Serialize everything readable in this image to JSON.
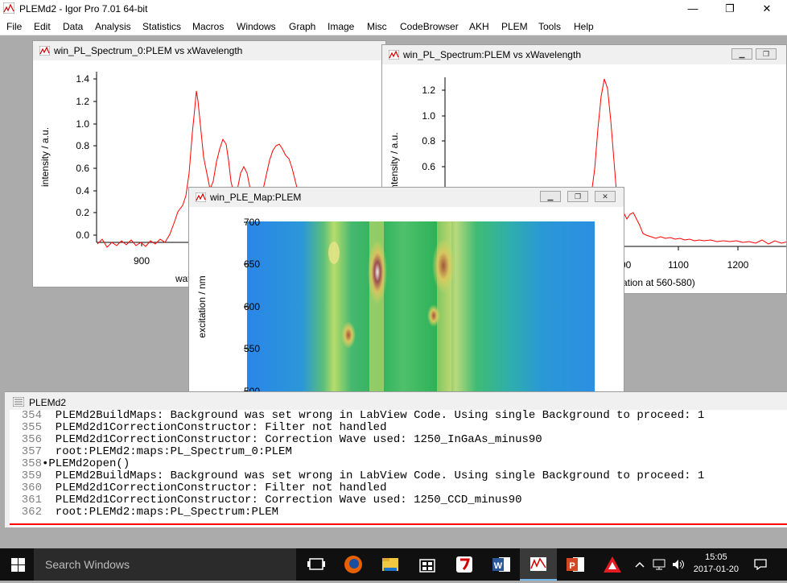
{
  "app": {
    "title": "PLEMd2 - Igor Pro 7.01 64-bit",
    "controls": {
      "minimize": "—",
      "maximize": "❐",
      "close": "✕"
    }
  },
  "menu": [
    "File",
    "Edit",
    "Data",
    "Analysis",
    "Statistics",
    "Macros",
    "Windows",
    "Graph",
    "Image",
    "Misc",
    "CodeBrowser",
    "AKH",
    "PLEM",
    "Tools",
    "Help"
  ],
  "windows": {
    "spectrum0": {
      "title": "win_PL_Spectrum_0:PLEM vs xWavelength",
      "ylabel": "intensity / a.u.",
      "xlabel_fragment": "wav",
      "yticks": [
        "1.4",
        "1.2",
        "1.0",
        "0.8",
        "0.6",
        "0.4",
        "0.2",
        "0.0"
      ],
      "xticks": [
        "900"
      ]
    },
    "spectrum": {
      "title": "win_PL_Spectrum:PLEM vs xWavelength",
      "ylabel_fragment": "ntensity / a.u.",
      "xlabel_fragment": "itation at 560-580)",
      "yticks": [
        "1.2",
        "1.0",
        "0.8",
        "0.6"
      ],
      "xticks": [
        "00",
        "1100",
        "1200"
      ]
    },
    "map": {
      "title": "win_PLE_Map:PLEM",
      "ylabel": "excitation / nm",
      "yticks": [
        "700",
        "650",
        "600",
        "550",
        "500"
      ]
    },
    "command": {
      "title": "PLEMd2",
      "lines": [
        {
          "n": "354",
          "t": "  PLEMd2BuildMaps: Background was set wrong in LabView Code. Using single Background to proceed: 1"
        },
        {
          "n": "355",
          "t": "  PLEMd2d1CorrectionConstructor: Filter not handled"
        },
        {
          "n": "356",
          "t": "  PLEMd2d1CorrectionConstructor: Correction Wave used: 1250_InGaAs_minus90"
        },
        {
          "n": "357",
          "t": "  root:PLEMd2:maps:PL_Spectrum_0:PLEM"
        },
        {
          "n": "358",
          "t": "•PLEMd2open()"
        },
        {
          "n": "359",
          "t": "  PLEMd2BuildMaps: Background was set wrong in LabView Code. Using single Background to proceed: 1"
        },
        {
          "n": "360",
          "t": "  PLEMd2d1CorrectionConstructor: Filter not handled"
        },
        {
          "n": "361",
          "t": "  PLEMd2d1CorrectionConstructor: Correction Wave used: 1250_CCD_minus90"
        },
        {
          "n": "362",
          "t": "  root:PLEMd2:maps:PL_Spectrum:PLEM"
        }
      ]
    }
  },
  "taskbar": {
    "search_placeholder": "Search Windows",
    "time": "15:05",
    "date": "2017-01-20"
  },
  "colors": {
    "trace": "#ff0000",
    "accent": "#76b9ed"
  }
}
